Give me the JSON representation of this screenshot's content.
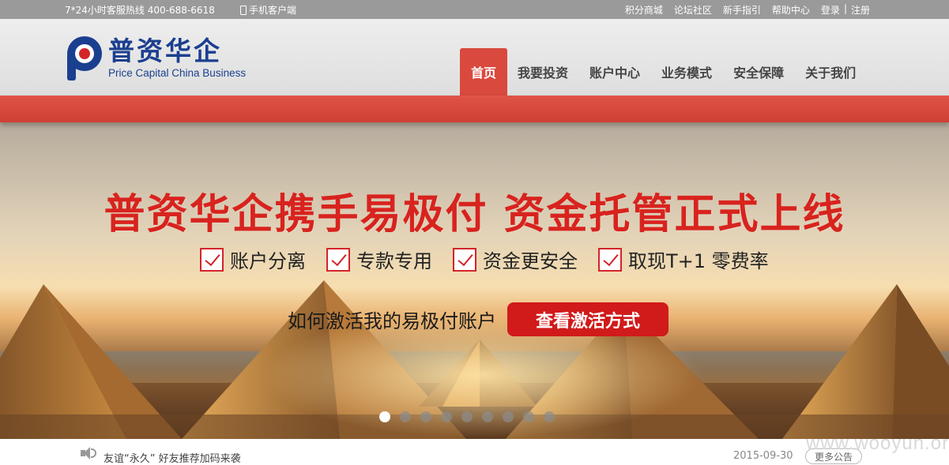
{
  "topbar": {
    "hotline": "7*24小时客服热线 400-688-6618",
    "mobile_client": "手机客户端",
    "links": [
      "积分商城",
      "论坛社区",
      "新手指引",
      "帮助中心"
    ],
    "login": "登录",
    "separator": "|",
    "register": "注册"
  },
  "logo": {
    "name_cn": "普资华企",
    "name_en": "Price Capital China Business"
  },
  "nav": {
    "items": [
      "首页",
      "我要投资",
      "账户中心",
      "业务模式",
      "安全保障",
      "关于我们"
    ],
    "active_index": 0
  },
  "banner": {
    "headline": "普资华企携手易极付 资金托管正式上线",
    "features": [
      "账户分离",
      "专款专用",
      "资金更安全",
      "取现T+1 零费率"
    ],
    "activate_question": "如何激活我的易极付账户",
    "activate_button": "查看激活方式",
    "slide_count": 9,
    "active_slide": 0
  },
  "notice": {
    "text": "友谊“永久” 好友推荐加码来袭",
    "date": "2015-09-30",
    "more_button": "更多公告"
  },
  "watermark": "www.wooyun.org",
  "colors": {
    "brand_blue": "#1b3f8f",
    "brand_red": "#d9493e",
    "headline_red": "#d8231e",
    "button_red": "#d11a1a"
  }
}
